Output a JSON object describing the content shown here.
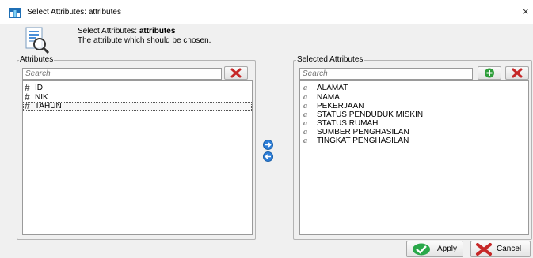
{
  "window": {
    "title": "Select Attributes: attributes",
    "close_glyph": "×"
  },
  "header": {
    "prefix": "Select Attributes: ",
    "name": "attributes",
    "description": "The attribute which should be chosen."
  },
  "left_panel": {
    "title": "Attributes",
    "search_placeholder": "Search",
    "items": [
      {
        "icon": "numeric-attribute-icon",
        "label": "ID"
      },
      {
        "icon": "numeric-attribute-icon",
        "label": "NIK"
      },
      {
        "icon": "numeric-attribute-icon",
        "label": "TAHUN"
      }
    ]
  },
  "right_panel": {
    "title": "Selected Attributes",
    "search_placeholder": "Search",
    "items": [
      {
        "icon": "nominal-attribute-icon",
        "label": "ALAMAT"
      },
      {
        "icon": "nominal-attribute-icon",
        "label": "NAMA"
      },
      {
        "icon": "nominal-attribute-icon",
        "label": "PEKERJAAN"
      },
      {
        "icon": "nominal-attribute-icon",
        "label": "STATUS PENDUDUK MISKIN"
      },
      {
        "icon": "nominal-attribute-icon",
        "label": "STATUS RUMAH"
      },
      {
        "icon": "nominal-attribute-icon",
        "label": "SUMBER PENGHASILAN"
      },
      {
        "icon": "nominal-attribute-icon",
        "label": "TINGKAT PENGHASILAN"
      }
    ]
  },
  "icons": {
    "hash_glyph": "#",
    "nominal_glyph": "a"
  },
  "footer": {
    "apply_label": "Apply",
    "cancel_label": "Cancel"
  },
  "colors": {
    "accent_blue": "#2d7ed8",
    "remove_red": "#c62828",
    "add_green": "#2e9e3a",
    "apply_green": "#2aa84a"
  }
}
